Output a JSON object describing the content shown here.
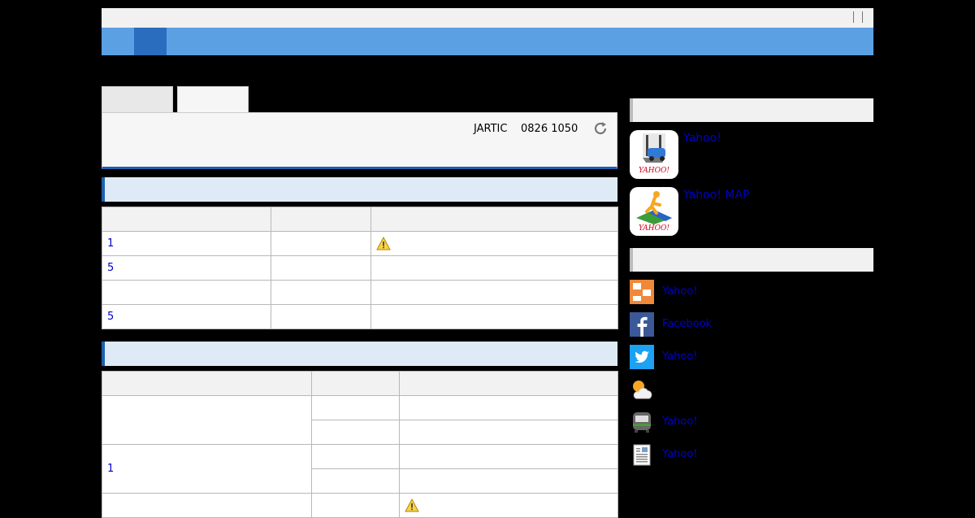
{
  "header": {
    "top_separators": [
      "",
      ""
    ]
  },
  "info_panel": {
    "source": "JARTIC",
    "time": "0826 1050",
    "reload_icon": "reload-icon"
  },
  "table1": {
    "rows": [
      {
        "col1": "1",
        "col2": "",
        "warning": true
      },
      {
        "col1": "5",
        "col2": "",
        "warning": false
      },
      {
        "col1": "",
        "col2": "",
        "warning": false
      },
      {
        "col1": "5",
        "col2": "",
        "warning": false
      }
    ]
  },
  "table2": {
    "group2_label": "1"
  },
  "sidebar": {
    "apps": [
      {
        "label": "Yahoo!",
        "icon": "car-navi-app-icon"
      },
      {
        "label": "Yahoo! MAP",
        "icon": "map-app-icon"
      }
    ],
    "links": [
      {
        "label": "Yahoo!",
        "icon": "blog-icon",
        "color": "#f0883a"
      },
      {
        "label": "Facebook",
        "icon": "facebook-icon",
        "color": "#3b5998"
      },
      {
        "label": "Yahoo!",
        "icon": "twitter-icon",
        "color": "#1da1f2"
      },
      {
        "label": "",
        "icon": "weather-icon",
        "color": "#f5a623"
      },
      {
        "label": "Yahoo!",
        "icon": "train-icon",
        "color": "#4a9a3b"
      },
      {
        "label": "Yahoo!",
        "icon": "news-icon",
        "color": "#888888"
      }
    ]
  }
}
